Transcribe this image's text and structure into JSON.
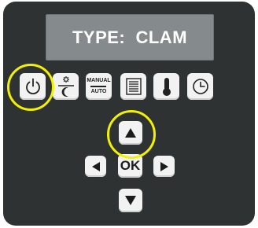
{
  "display": {
    "text": "TYPE:  CLAM"
  },
  "function_keys": [
    {
      "name": "power",
      "icon": "power-icon"
    },
    {
      "name": "day-night",
      "icon": "sun-moon-icon"
    },
    {
      "name": "manual-auto",
      "icon": "manual-auto-icon",
      "label_top": "MANUAL",
      "label_bottom": "AUTO"
    },
    {
      "name": "list",
      "icon": "document-list-icon"
    },
    {
      "name": "temperature",
      "icon": "thermometer-icon"
    },
    {
      "name": "clock",
      "icon": "clock-icon"
    }
  ],
  "nav": {
    "ok_label": "OK"
  },
  "highlight_color": "#f2f200",
  "panel_color": "#2f3233",
  "display_color": "#858a8c"
}
